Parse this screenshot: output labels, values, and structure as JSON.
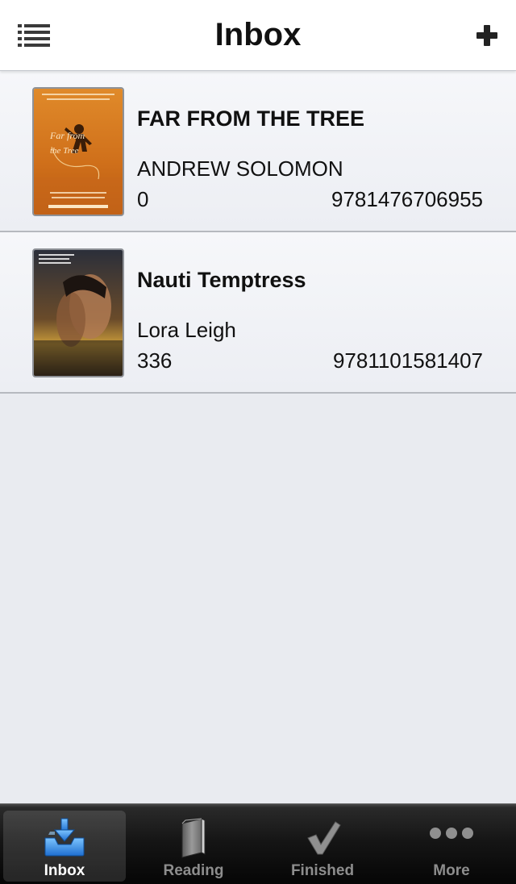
{
  "nav": {
    "title": "Inbox",
    "left_icon": "list-icon",
    "right_icon": "plus-icon"
  },
  "books": [
    {
      "title": "FAR FROM THE TREE",
      "author": "ANDREW SOLOMON",
      "pages": "0",
      "isbn": "9781476706955",
      "cover_icon": "book-cover-far-from-the-tree"
    },
    {
      "title": "Nauti Temptress",
      "author": "Lora Leigh",
      "pages": "336",
      "isbn": "9781101581407",
      "cover_icon": "book-cover-nauti-temptress"
    }
  ],
  "tabs": [
    {
      "label": "Inbox",
      "icon": "inbox-tray-icon",
      "active": true
    },
    {
      "label": "Reading",
      "icon": "book-icon",
      "active": false
    },
    {
      "label": "Finished",
      "icon": "checkmark-icon",
      "active": false
    },
    {
      "label": "More",
      "icon": "more-dots-icon",
      "active": false
    }
  ],
  "colors": {
    "background": "#e9ebf0",
    "navbar": "#ffffff",
    "tabbar": "#151515",
    "active_tab_icon": "#2d8be0",
    "inactive_tab": "#8d8d8d"
  }
}
